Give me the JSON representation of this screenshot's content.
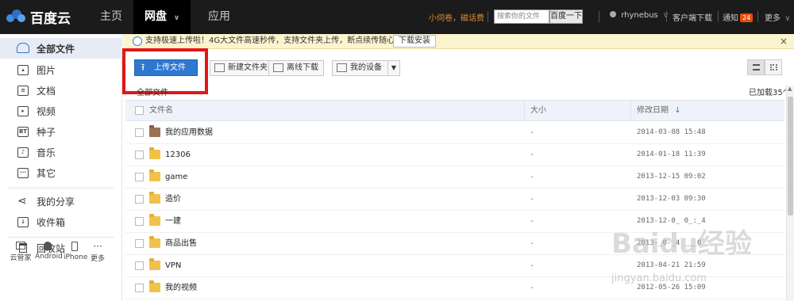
{
  "brand": {
    "name": "百度云"
  },
  "nav": {
    "home": "主页",
    "netdisk": "网盘",
    "apps": "应用"
  },
  "top": {
    "promo": "小伺卷，磁话费",
    "search_placeholder": "搜索你的文件",
    "search_button": "百度一下",
    "username": "rhynebus",
    "client_download": "客户端下载",
    "notify": "通知",
    "notify_count": "24",
    "more": "更多"
  },
  "sidebar": {
    "items": [
      {
        "label": "全部文件",
        "icon": "folder-icon"
      },
      {
        "label": "图片",
        "icon": "image-icon"
      },
      {
        "label": "文档",
        "icon": "document-icon"
      },
      {
        "label": "视频",
        "icon": "video-icon"
      },
      {
        "label": "种子",
        "icon": "bt-icon"
      },
      {
        "label": "音乐",
        "icon": "music-icon"
      },
      {
        "label": "其它",
        "icon": "other-icon"
      },
      {
        "label": "我的分享",
        "icon": "share-icon"
      },
      {
        "label": "收件箱",
        "icon": "inbox-icon"
      },
      {
        "label": "回收站",
        "icon": "trash-icon"
      }
    ],
    "devices": [
      "云管家",
      "Android",
      "iPhone",
      "更多"
    ],
    "bt_text": "BT",
    "more_dots": "···"
  },
  "notice": {
    "text": "支持极速上传啦！4G大文件高速秒传，支持文件夹上传，断点续传随心所欲！",
    "button": "下载安装",
    "close": "×"
  },
  "toolbar": {
    "upload": "上传文件",
    "new_folder": "新建文件夹",
    "offline": "离线下载",
    "devices": "我的设备"
  },
  "breadcrumb": "全部文件",
  "loaded_count": "已加载35个",
  "table": {
    "headers": {
      "name": "文件名",
      "size": "大小",
      "modified": "修改日期"
    },
    "rows": [
      {
        "name": "我的应用数据",
        "size": "-",
        "date": "2014-03-08 15:48",
        "type": "app"
      },
      {
        "name": "12306",
        "size": "-",
        "date": "2014-01-18 11:39",
        "type": "folder"
      },
      {
        "name": "game",
        "size": "-",
        "date": "2013-12-15 09:02",
        "type": "folder"
      },
      {
        "name": "造价",
        "size": "-",
        "date": "2013-12-03 09:30",
        "type": "folder"
      },
      {
        "name": "一建",
        "size": "-",
        "date": "2013-12-0_ 0_:_4",
        "type": "folder"
      },
      {
        "name": "商品出售",
        "size": "-",
        "date": "2013-_0-_4 ___0",
        "type": "folder"
      },
      {
        "name": "VPN",
        "size": "-",
        "date": "2013-04-21 21:59",
        "type": "folder"
      },
      {
        "name": "我的视频",
        "size": "-",
        "date": "2012-05-26 15:09",
        "type": "folder"
      }
    ]
  },
  "watermark": {
    "main": "Baidu经验",
    "sub": "jingyan.baidu.com"
  },
  "colors": {
    "accent": "#2f78d2",
    "highlight": "#e31616",
    "topbar": "#1b1b1b"
  }
}
